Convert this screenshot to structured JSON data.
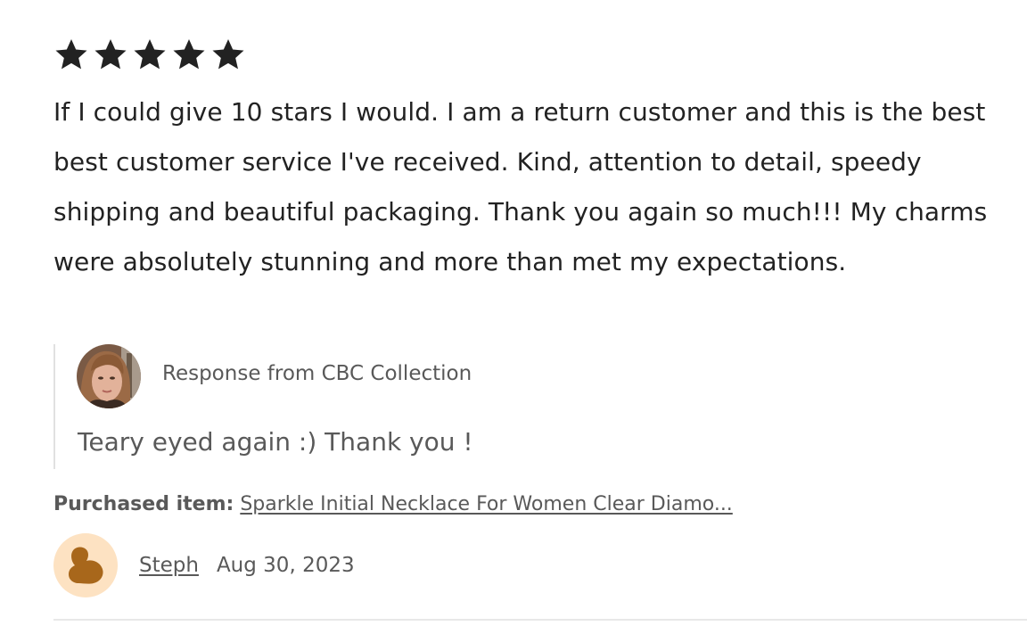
{
  "review": {
    "rating": 5,
    "rating_max": 5,
    "star_color": "#222222",
    "text": "If I could give 10 stars I would. I am a return customer and this is the best best customer service I've received. Kind, attention to detail, speedy shipping and beautiful packaging. Thank you again so much!!! My charms were absolutely stunning and more than met my expectations."
  },
  "response": {
    "avatar_icon": "seller-avatar-photo",
    "from_label": "Response from CBC Collection",
    "text": "Teary eyed again :) Thank you !"
  },
  "purchase": {
    "label": "Purchased item:",
    "item_link": "Sparkle Initial Necklace For Women Clear Diamo..."
  },
  "reviewer": {
    "avatar_icon": "default-user-avatar-icon",
    "avatar_bg": "#fde2c2",
    "avatar_fg": "#a8671b",
    "name": "Steph",
    "date": "Aug 30, 2023"
  }
}
